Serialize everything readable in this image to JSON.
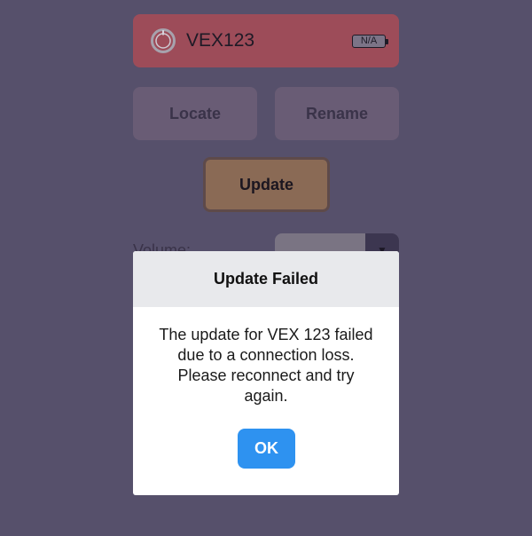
{
  "device": {
    "name": "VEX123",
    "battery_text": "N/A",
    "power_icon": "power-ring-icon"
  },
  "actions": {
    "locate_label": "Locate",
    "rename_label": "Rename",
    "update_label": "Update"
  },
  "volume": {
    "label": "Volume:",
    "selected_value": "",
    "dropdown_icon": "dropdown-triangle-icon"
  },
  "dialog": {
    "title": "Update Failed",
    "message": "The update for VEX 123 failed due to a connection loss. Please reconnect and try again.",
    "ok_label": "OK"
  },
  "colors": {
    "overlay_background": "#56506b",
    "device_header": "#9d4c59",
    "ok_button": "#2e92f0",
    "dialog_header": "#e8e9ec"
  }
}
